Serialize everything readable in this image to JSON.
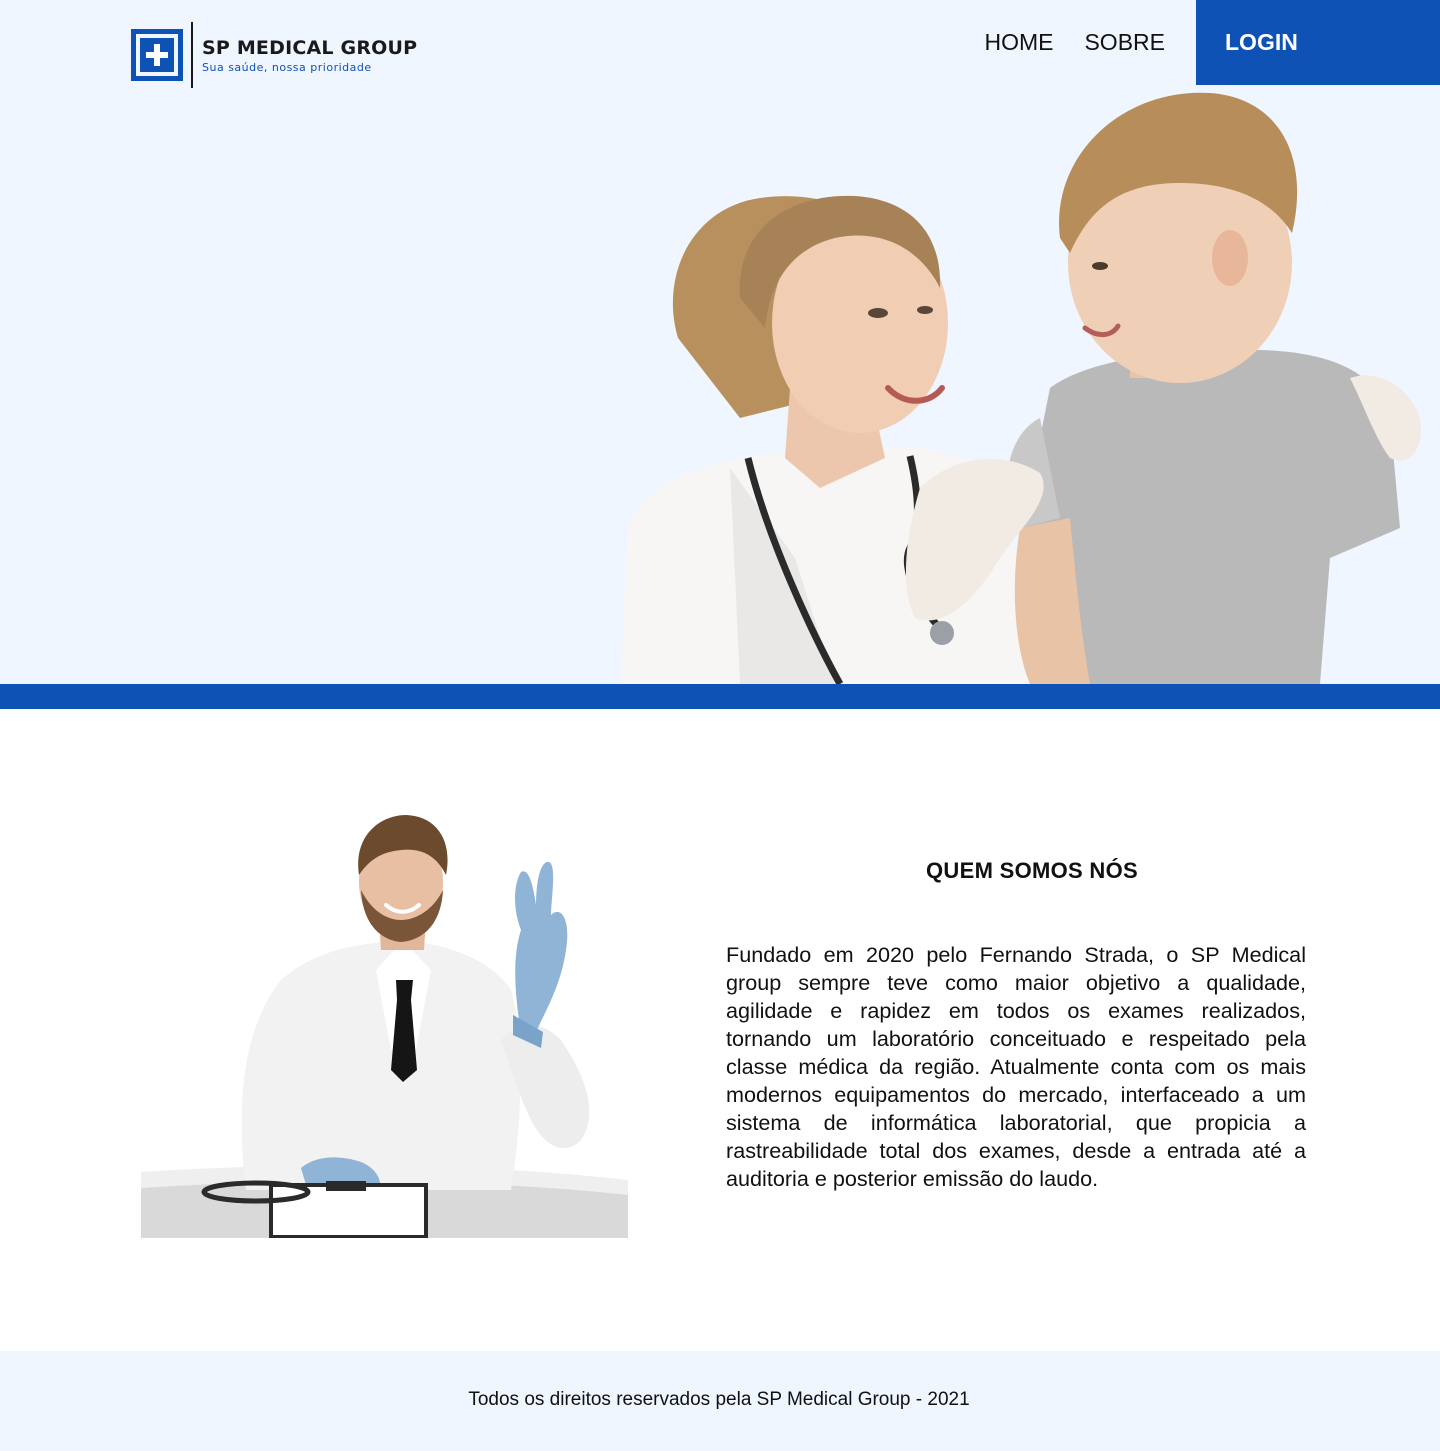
{
  "header": {
    "logo": {
      "name": "SP MEDICAL GROUP",
      "tagline": "Sua saúde, nossa prioridade"
    },
    "nav": {
      "home_label": "HOME",
      "sobre_label": "SOBRE",
      "login_label": "LOGIN"
    }
  },
  "about": {
    "title": "QUEM SOMOS NÓS",
    "text": "Fundado em 2020 pelo Fernando Strada, o SP Medical group sempre teve como maior objetivo a qualidade, agilidade e rapidez em todos os exames realizados, tornando um laboratório conceituado e respeitado pela classe médica da região. Atualmente conta com os mais modernos equipamentos do mercado, interfaceado a um sistema de informática laboratorial, que propicia a rastreabilidade total dos exames, desde a entrada até a auditoria e posterior emissão do laudo."
  },
  "footer": {
    "text": "Todos os direitos reservados pela SP Medical Group - 2021"
  },
  "colors": {
    "brand_blue": "#0f52b5",
    "hero_background": "#eff6ff"
  }
}
